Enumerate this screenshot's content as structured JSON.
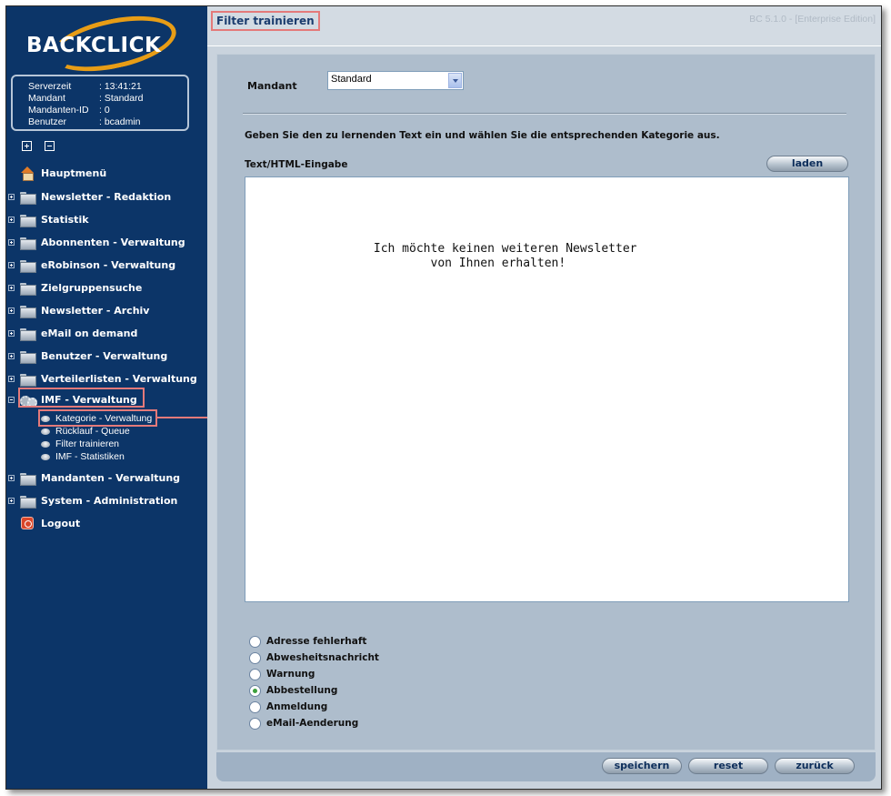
{
  "app": {
    "logo_text": "BACKCLICK",
    "version": "BC 5.1.0 - [Enterprise Edition]"
  },
  "session": {
    "rows": [
      {
        "key": "Serverzeit",
        "value": ": 13:41:21"
      },
      {
        "key": "Mandant",
        "value": ": Standard"
      },
      {
        "key": "Mandanten-ID",
        "value": ": 0"
      },
      {
        "key": "Benutzer",
        "value": ": bcadmin"
      }
    ]
  },
  "nav": {
    "home": "Hauptmenü",
    "items": [
      "Newsletter - Redaktion",
      "Statistik",
      "Abonnenten - Verwaltung",
      "eRobinson - Verwaltung",
      "Zielgruppensuche",
      "Newsletter - Archiv",
      "eMail on demand",
      "Benutzer - Verwaltung",
      "Verteilerlisten - Verwaltung",
      "IMF - Verwaltung"
    ],
    "imf_sub": [
      "Kategorie - Verwaltung",
      "Rücklauf - Queue",
      "Filter trainieren",
      "IMF - Statistiken"
    ],
    "after": [
      "Mandanten - Verwaltung",
      "System - Administration"
    ],
    "logout": "Logout"
  },
  "page": {
    "title": "Filter trainieren",
    "mandant_label": "Mandant",
    "mandant_value": "Standard",
    "instruction": "Geben Sie den zu lernenden Text ein und wählen Sie die entsprechenden Kategorie aus.",
    "text_label": "Text/HTML-Eingabe",
    "load_button": "laden",
    "text_content": "                  Ich möchte keinen weiteren Newsletter\n                          von Ihnen erhalten!",
    "categories": [
      {
        "label": "Adresse fehlerhaft",
        "checked": false
      },
      {
        "label": "Abwesheitsnachricht",
        "checked": false
      },
      {
        "label": "Warnung",
        "checked": false
      },
      {
        "label": "Abbestellung",
        "checked": true
      },
      {
        "label": "Anmeldung",
        "checked": false
      },
      {
        "label": "eMail-Aenderung",
        "checked": false
      }
    ],
    "buttons": {
      "save": "speichern",
      "reset": "reset",
      "back": "zurück"
    }
  },
  "colors": {
    "sidebar": "#0c3568",
    "accent_orange": "#e89d16",
    "highlight": "#e47a7a",
    "content_bg": "#aebdcc"
  }
}
